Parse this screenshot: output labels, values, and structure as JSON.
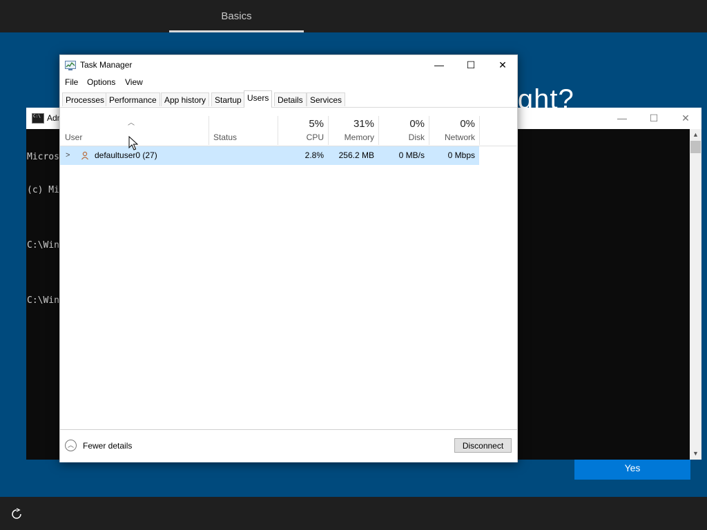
{
  "oobe": {
    "tab_label": "Basics",
    "heading_fragment": "ight?",
    "yes_label": "Yes",
    "accessibility_icon": "accessibility-icon"
  },
  "console": {
    "title": "Adm",
    "lines": [
      "Micros",
      "(c) Mi",
      "",
      "C:\\Win",
      "",
      "C:\\Win"
    ],
    "controls": {
      "minimize": "—",
      "maximize": "☐",
      "close": "✕"
    }
  },
  "task_manager": {
    "title": "Task Manager",
    "controls": {
      "minimize": "—",
      "maximize": "☐",
      "close": "✕"
    },
    "menu": [
      "File",
      "Options",
      "View"
    ],
    "tabs": [
      "Processes",
      "Performance",
      "App history",
      "Startup",
      "Users",
      "Details",
      "Services"
    ],
    "active_tab": "Users",
    "columns": {
      "user": "User",
      "status": "Status",
      "cpu": {
        "pct": "5%",
        "label": "CPU"
      },
      "memory": {
        "pct": "31%",
        "label": "Memory"
      },
      "disk": {
        "pct": "0%",
        "label": "Disk"
      },
      "network": {
        "pct": "0%",
        "label": "Network"
      }
    },
    "rows": [
      {
        "name": "defaultuser0 (27)",
        "status": "",
        "cpu": "2.8%",
        "memory": "256.2 MB",
        "disk": "0 MB/s",
        "network": "0 Mbps"
      }
    ],
    "footer": {
      "fewer_details": "Fewer details",
      "disconnect": "Disconnect"
    }
  },
  "colors": {
    "desktop_bg": "#004a7d",
    "selected_row": "#cce8ff",
    "accent_button": "#0078d7"
  }
}
